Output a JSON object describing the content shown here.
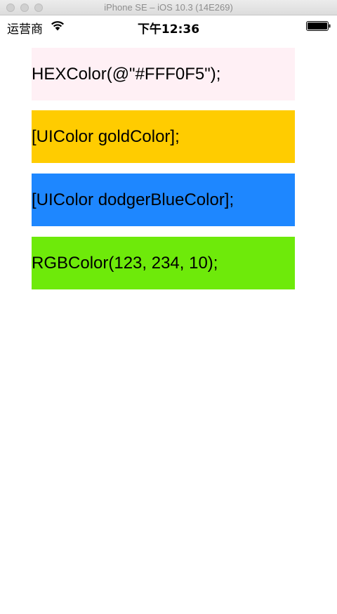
{
  "window": {
    "title": "iPhone SE – iOS 10.3 (14E269)"
  },
  "status_bar": {
    "carrier": "运营商",
    "time": "下午12:36",
    "wifi_icon": "wifi-icon",
    "battery_icon": "battery-icon"
  },
  "labels": [
    {
      "text": "HEXColor(@\"#FFF0F5\");",
      "background": "#FFF0F5"
    },
    {
      "text": "[UIColor goldColor];",
      "background": "#FFCC00"
    },
    {
      "text": "[UIColor dodgerBlueColor];",
      "background": "#1E87FF"
    },
    {
      "text": "RGBColor(123, 234, 10);",
      "background": "#6EEA0A"
    }
  ]
}
